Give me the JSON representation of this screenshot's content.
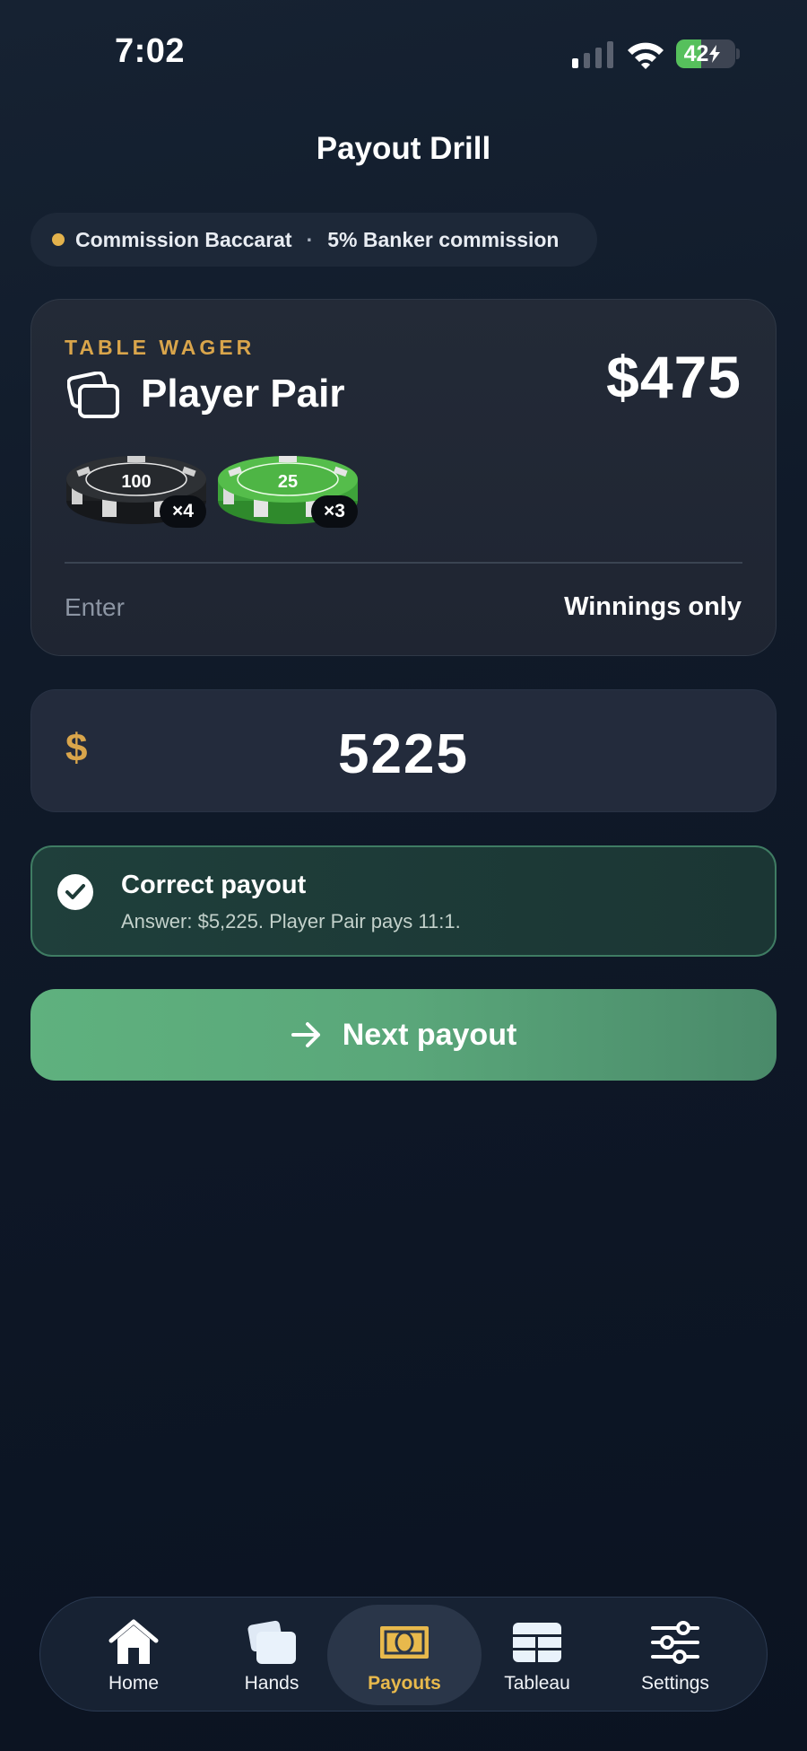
{
  "status_bar": {
    "time": "7:02",
    "battery": "42",
    "battery_level": 0.42
  },
  "header": {
    "title": "Payout Drill"
  },
  "mode": {
    "game": "Commission Baccarat",
    "separator": "·",
    "rule": "5% Banker commission"
  },
  "wager": {
    "eyebrow": "TABLE WAGER",
    "name": "Player Pair",
    "amount": "$475",
    "icon": "cards-icon",
    "chips": [
      {
        "denomination": "100",
        "count": "×4",
        "color": "#2a2d31"
      },
      {
        "denomination": "25",
        "count": "×3",
        "color": "#4bb544"
      }
    ],
    "enter_label": "Enter",
    "winnings_label": "Winnings only"
  },
  "answer": {
    "currency": "$",
    "value": "5225"
  },
  "feedback": {
    "title": "Correct payout",
    "detail": "Answer: $5,225. Player Pair pays 11:1.",
    "accent": "#3f7c63"
  },
  "next_button": {
    "label": "Next payout"
  },
  "tabs": [
    {
      "label": "Home",
      "icon": "home-icon"
    },
    {
      "label": "Hands",
      "icon": "cards-icon"
    },
    {
      "label": "Payouts",
      "icon": "banknote-icon",
      "active": true
    },
    {
      "label": "Tableau",
      "icon": "table-grid-icon"
    },
    {
      "label": "Settings",
      "icon": "sliders-icon"
    }
  ],
  "colors": {
    "accent_gold": "#d9a54b",
    "success_green": "#5fb17e",
    "background": "#101a29"
  }
}
